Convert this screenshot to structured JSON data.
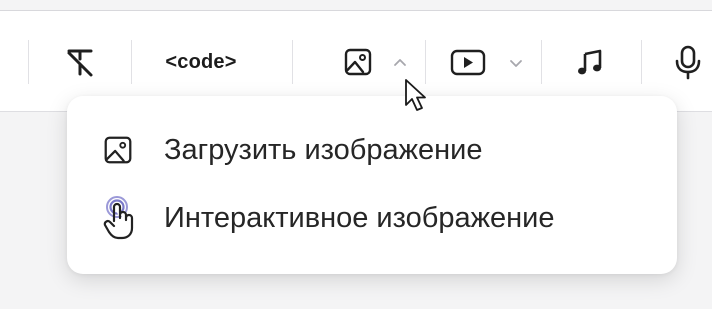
{
  "toolbar": {
    "code_label": "<code>",
    "buttons": [
      {
        "name": "clear-format",
        "icon": "clear-format-icon"
      },
      {
        "name": "code",
        "icon": "code-icon"
      },
      {
        "name": "image",
        "icon": "image-icon",
        "expanded": true
      },
      {
        "name": "video",
        "icon": "video-icon"
      },
      {
        "name": "audio",
        "icon": "music-note-icon"
      },
      {
        "name": "microphone",
        "icon": "microphone-icon"
      }
    ]
  },
  "image_menu": {
    "items": [
      {
        "label": "Загрузить изображение",
        "icon": "image-icon"
      },
      {
        "label": "Интерактивное изображение",
        "icon": "hand-pointer-icon"
      }
    ]
  },
  "colors": {
    "background": "#f4f4f5",
    "surface": "#ffffff",
    "text": "#262626",
    "interactive_accent": "#7b79c9"
  }
}
